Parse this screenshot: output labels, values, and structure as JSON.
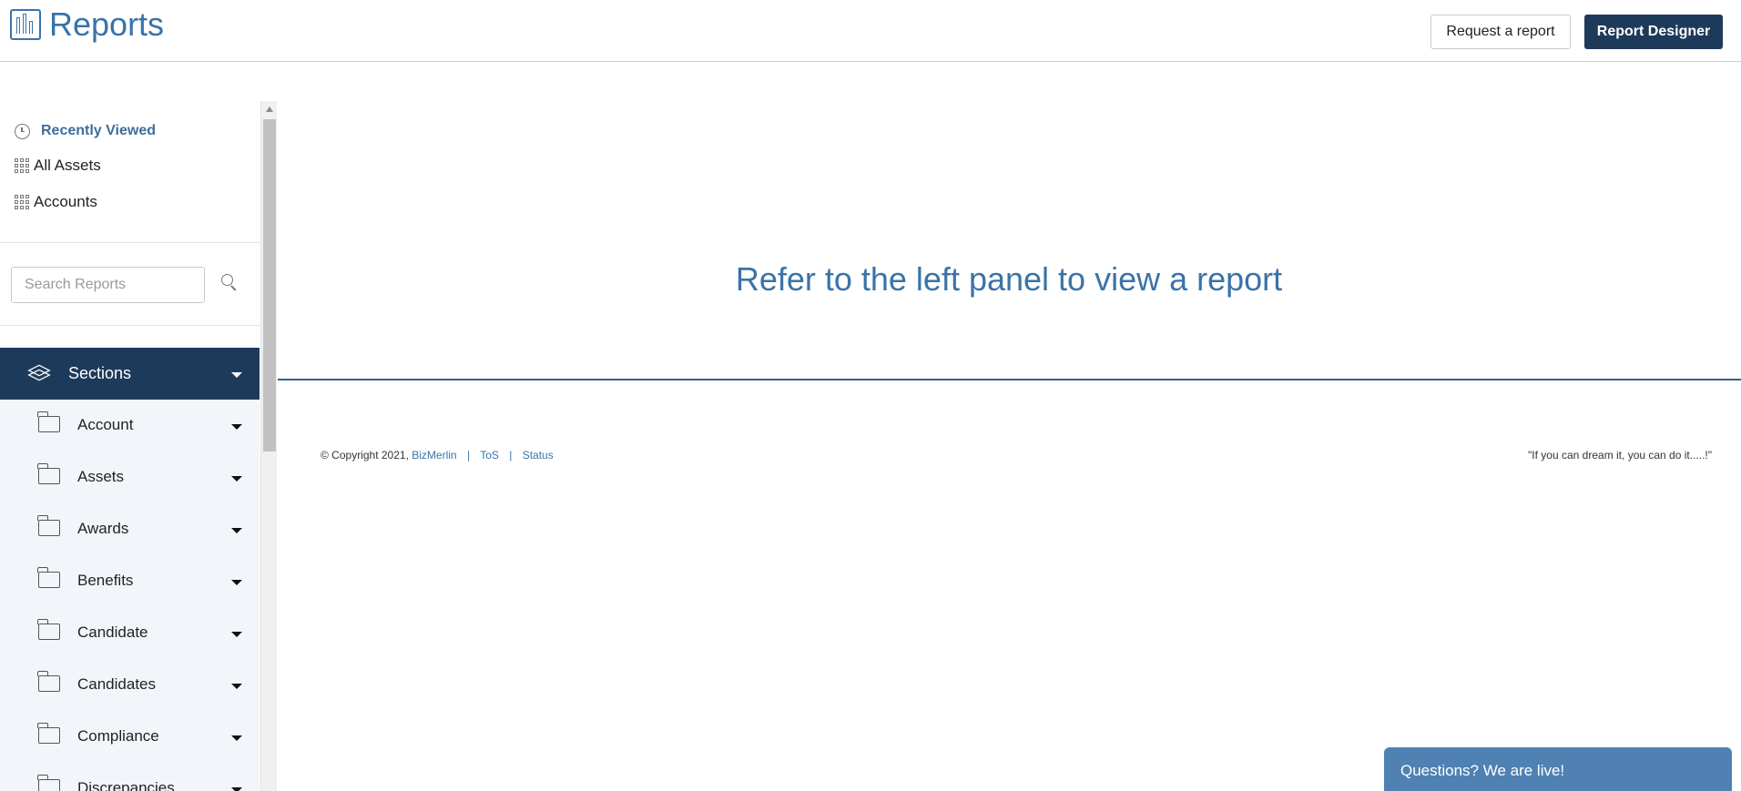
{
  "header": {
    "title": "Reports",
    "request_button": "Request a report",
    "designer_button": "Report Designer"
  },
  "recent": {
    "title": "Recently Viewed",
    "items": [
      "All Assets",
      "Accounts"
    ]
  },
  "search": {
    "placeholder": "Search Reports",
    "value": ""
  },
  "sections": {
    "title": "Sections",
    "items": [
      "Account",
      "Assets",
      "Awards",
      "Benefits",
      "Candidate",
      "Candidates",
      "Compliance",
      "Discrepancies"
    ]
  },
  "main": {
    "message": "Refer to the left panel to view a report"
  },
  "footer": {
    "copyright": "© Copyright 2021,",
    "company_link": "BizMerlin",
    "separator": "|",
    "tos_link": "ToS",
    "status_link": "Status",
    "tagline": "\"If you can dream it, you can do it.....!\""
  },
  "chat": {
    "label": "Questions? We are live!"
  },
  "colors": {
    "accent": "#3a73a8",
    "dark": "#1e3a5b",
    "chat": "#4f81b3"
  }
}
